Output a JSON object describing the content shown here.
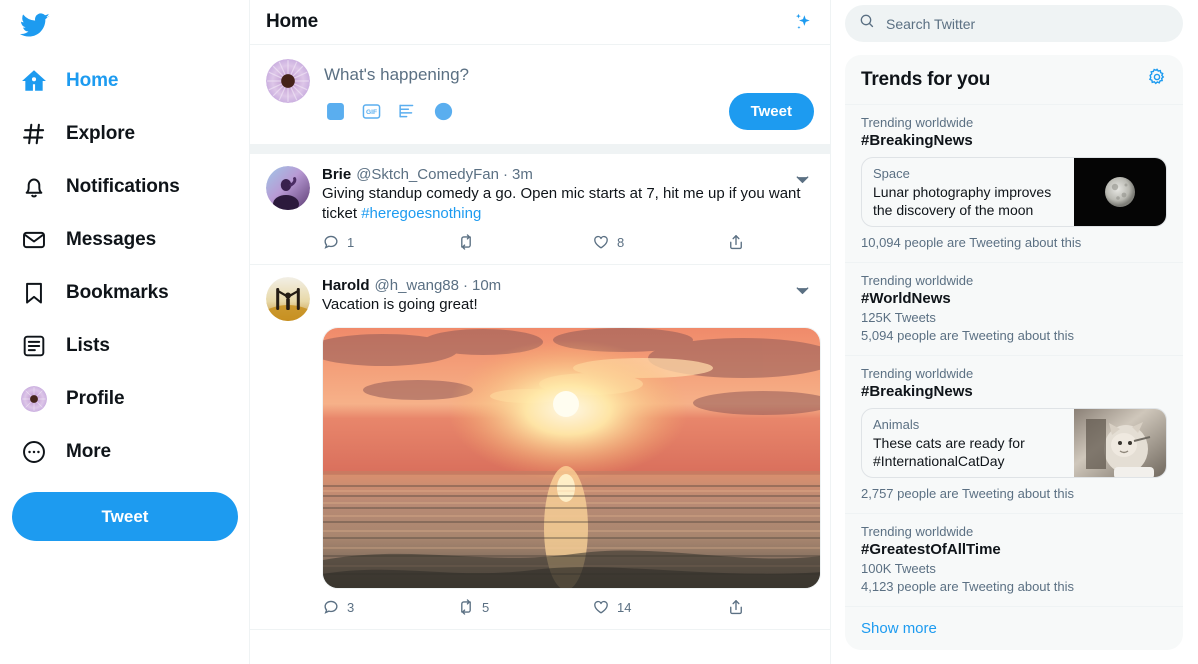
{
  "colors": {
    "brand": "#1d9bf0",
    "text": "#0f1419",
    "muted": "#5b7083",
    "divider": "#eff3f4",
    "panel_bg": "#f7f9f9"
  },
  "sidebar": {
    "logo": "twitter-bird-logo",
    "items": [
      {
        "label": "Home",
        "icon": "home-icon",
        "active": true
      },
      {
        "label": "Explore",
        "icon": "hashtag-icon",
        "active": false
      },
      {
        "label": "Notifications",
        "icon": "bell-icon",
        "active": false
      },
      {
        "label": "Messages",
        "icon": "envelope-icon",
        "active": false
      },
      {
        "label": "Bookmarks",
        "icon": "bookmark-icon",
        "active": false
      },
      {
        "label": "Lists",
        "icon": "list-icon",
        "active": false
      },
      {
        "label": "Profile",
        "icon": "profile-avatar-icon",
        "active": false
      },
      {
        "label": "More",
        "icon": "more-circle-icon",
        "active": false
      }
    ],
    "tweet_button": "Tweet"
  },
  "header": {
    "title": "Home",
    "sparkle_icon": "sparkle-icon"
  },
  "compose": {
    "avatar": "user-avatar-flower",
    "placeholder": "What's happening?",
    "icons": [
      {
        "name": "image-icon",
        "label": "Media"
      },
      {
        "name": "gif-icon",
        "label": "GIF"
      },
      {
        "name": "poll-icon",
        "label": "Poll"
      },
      {
        "name": "emoji-icon",
        "label": "Emoji"
      }
    ],
    "tweet_button": "Tweet"
  },
  "feed": {
    "tweets": [
      {
        "avatar": "brie-avatar",
        "name": "Brie",
        "handle": "@Sktch_ComedyFan",
        "separator": "·",
        "time": "3m",
        "text_before": "Giving standup comedy a go. Open mic starts at 7, hit me up if you want ticket ",
        "hashtag": "#heregoesnothing",
        "has_media": false,
        "actions": {
          "reply": "1",
          "retweet": "",
          "like": "8",
          "share": ""
        }
      },
      {
        "avatar": "harold-avatar",
        "name": "Harold",
        "handle": "@h_wang88",
        "separator": "·",
        "time": "10m",
        "text_before": "Vacation is going great!",
        "hashtag": "",
        "has_media": true,
        "media_alt": "sunset-over-ocean-photo",
        "actions": {
          "reply": "3",
          "retweet": "5",
          "like": "14",
          "share": ""
        }
      }
    ]
  },
  "search": {
    "placeholder": "Search Twitter",
    "value": "",
    "icon": "search-icon"
  },
  "trends": {
    "title": "Trends for you",
    "settings_icon": "gear-icon",
    "show_more": "Show more",
    "items": [
      {
        "category": "Trending worldwide",
        "tag": "#BreakingNews",
        "tweet_count": "",
        "people": "10,094 people are Tweeting about this",
        "card": {
          "category": "Space",
          "title": "Lunar photography improves the discovery of the moon",
          "image": "moon-photo"
        }
      },
      {
        "category": "Trending worldwide",
        "tag": "#WorldNews",
        "tweet_count": "125K Tweets",
        "people": "5,094 people are Tweeting about this",
        "card": null
      },
      {
        "category": "Trending worldwide",
        "tag": "#BreakingNews",
        "tweet_count": "",
        "people": "2,757 people are Tweeting about this",
        "card": {
          "category": "Animals",
          "title": "These cats are ready for #InternationalCatDay",
          "image": "cat-photo"
        }
      },
      {
        "category": "Trending worldwide",
        "tag": "#GreatestOfAllTime",
        "tweet_count": "100K Tweets",
        "people": "4,123 people are Tweeting about this",
        "card": null
      }
    ]
  }
}
